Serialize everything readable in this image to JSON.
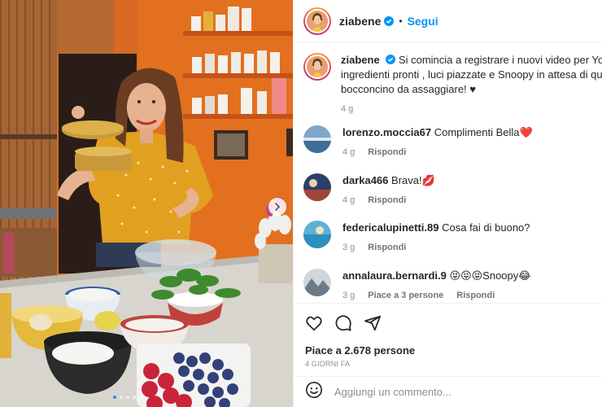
{
  "post": {
    "author": "ziabene",
    "follow_label": "Segui",
    "separator": "•",
    "caption": "Si comincia a registrare i nuovi video per YouT",
    "caption_line2": "ingredienti pronti , luci piazzate e Snoopy in attesa di qua",
    "caption_line3": "bocconcino da assaggiare! ♥",
    "caption_age": "4 g"
  },
  "comments": [
    {
      "user": "lorenzo.moccia67",
      "text": "Complimenti Bella❤️",
      "age": "4 g",
      "reply": "Rispondi",
      "likes": ""
    },
    {
      "user": "darka466",
      "text": "Brava!💋",
      "age": "4 g",
      "reply": "Rispondi",
      "likes": ""
    },
    {
      "user": "federicalupinetti.89",
      "text": "Cosa fai di buono?",
      "age": "3 g",
      "reply": "Rispondi",
      "likes": ""
    },
    {
      "user": "annalaura.bernardi.9",
      "text": "😝😝😝Snoopy😂",
      "age": "3 g",
      "reply": "Rispondi",
      "likes": "Piace a 3 persone"
    }
  ],
  "stats": {
    "likes_text": "Piace a 2.678 persone",
    "date_text": "4 GIORNI FA"
  },
  "composer": {
    "placeholder": "Aggiungi un commento..."
  },
  "icons": {
    "like": "heart-icon",
    "comment": "comment-icon",
    "share": "share-icon",
    "emoji": "emoji-icon",
    "next": "chevron-right-icon",
    "verified": "verified-badge-icon"
  },
  "colors": {
    "accent": "#0095f6",
    "text": "#262626",
    "muted": "#8e8e8e",
    "wall": "#d2691e"
  },
  "carousel": {
    "slides": 5,
    "active": 1
  }
}
